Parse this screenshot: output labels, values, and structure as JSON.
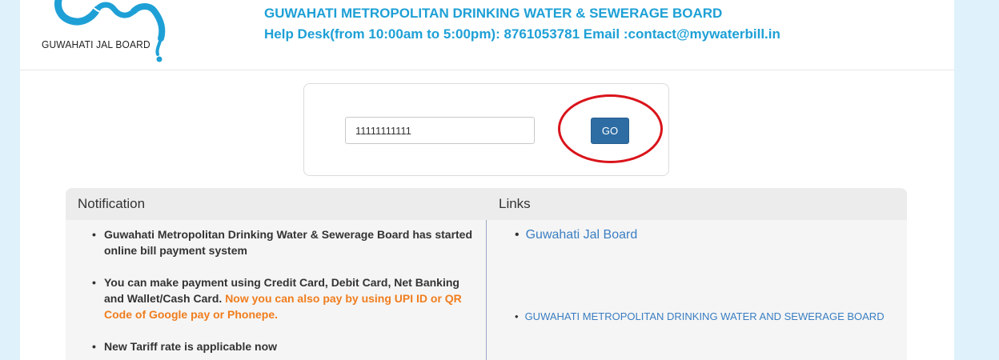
{
  "header": {
    "logo_text": "GUWAHATI JAL BOARD",
    "org_title": "GUWAHATI METROPOLITAN DRINKING WATER & SEWERAGE BOARD",
    "helpdesk": "Help Desk(from 10:00am to 5:00pm): 8761053781 Email :contact@mywaterbill.in"
  },
  "search": {
    "account_value": "11111111111",
    "go_label": "GO"
  },
  "panel": {
    "notification_heading": "Notification",
    "links_heading": "Links",
    "notifications": [
      {
        "text": "Guwahati Metropolitan Drinking Water & Sewerage Board has started online bill payment system"
      },
      {
        "text": "You can make payment using Credit Card, Debit Card, Net Banking and Wallet/Cash Card.",
        "highlight": "Now you can also pay by using UPI ID or QR Code of Google pay or Phonepe."
      },
      {
        "text": "New Tariff rate is applicable now"
      }
    ],
    "links": [
      {
        "label": "Guwahati Jal Board"
      },
      {
        "label": "GUWAHATI METROPOLITAN DRINKING WATER AND SEWERAGE BOARD"
      }
    ]
  },
  "colors": {
    "accent": "#1ea0d6",
    "button": "#2e6da4",
    "highlight": "#f07d1d",
    "annotation": "#d9141b"
  }
}
